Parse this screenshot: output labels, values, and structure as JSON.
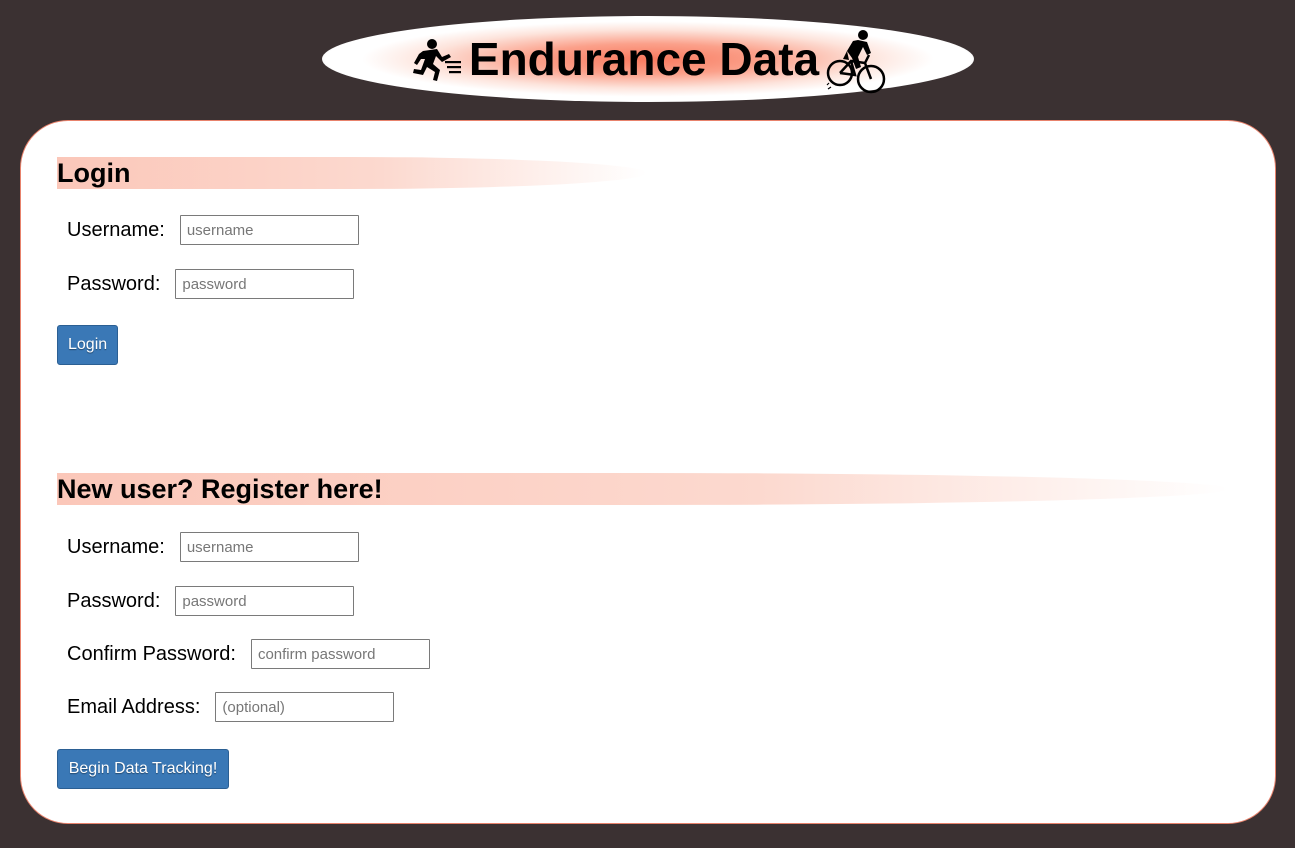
{
  "header": {
    "title": "Endurance Data",
    "left_icon": "runner-icon",
    "right_icon": "cyclist-icon"
  },
  "login": {
    "title": "Login",
    "username_label": "Username:",
    "username_placeholder": "username",
    "password_label": "Password:",
    "password_placeholder": "password",
    "button_label": "Login"
  },
  "register": {
    "title": "New user? Register here!",
    "username_label": "Username:",
    "username_placeholder": "username",
    "password_label": "Password:",
    "password_placeholder": "password",
    "confirm_label": "Confirm Password:",
    "confirm_placeholder": "confirm password",
    "email_label": "Email Address:",
    "email_placeholder": "(optional)",
    "button_label": "Begin Data Tracking!"
  },
  "colors": {
    "background": "#3b3132",
    "accent": "#f97a5f",
    "button": "#3a78b6"
  }
}
